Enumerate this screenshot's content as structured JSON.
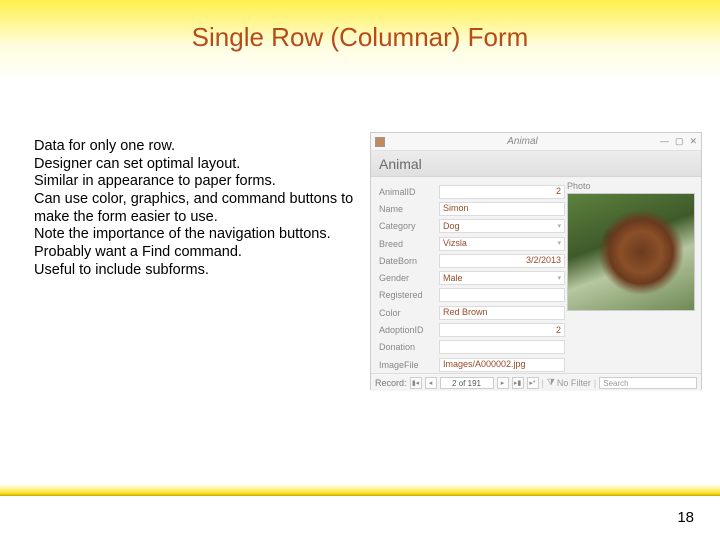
{
  "slide": {
    "title": "Single Row (Columnar) Form",
    "page_number": "18"
  },
  "bullets": [
    "Data for only one row.",
    "Designer can set optimal layout.",
    "Similar in appearance to paper forms.",
    "Can use color, graphics, and command buttons to make the form easier to use.",
    "Note the importance of the navigation buttons.",
    "Probably want a Find command.",
    "Useful to include subforms."
  ],
  "form": {
    "window_caption": "Animal",
    "header": "Animal",
    "photo_label": "Photo",
    "fields": {
      "animal_id_label": "AnimalID",
      "animal_id_value": "2",
      "name_label": "Name",
      "name_value": "Simon",
      "category_label": "Category",
      "category_value": "Dog",
      "breed_label": "Breed",
      "breed_value": "Vizsla",
      "dateborn_label": "DateBorn",
      "dateborn_value": "3/2/2013",
      "gender_label": "Gender",
      "gender_value": "Male",
      "registered_label": "Registered",
      "registered_value": "",
      "color_label": "Color",
      "color_value": "Red Brown",
      "adoptionid_label": "AdoptionID",
      "adoptionid_value": "2",
      "donation_label": "Donation",
      "donation_value": "",
      "imagefile_label": "ImageFile",
      "imagefile_value": "Images/A000002.jpg"
    },
    "nav": {
      "record_label": "Record:",
      "position": "2 of 191",
      "no_filter": "No Filter",
      "search_placeholder": "Search"
    }
  }
}
